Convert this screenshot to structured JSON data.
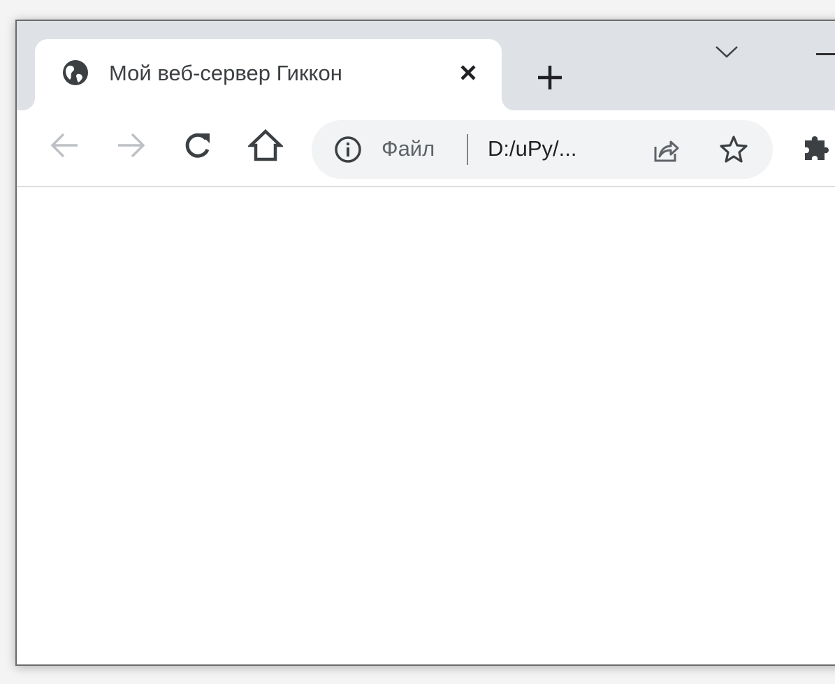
{
  "tab": {
    "title": "Мой веб-сервер Гиккон",
    "favicon": "globe-icon",
    "close_icon": "close-icon"
  },
  "tabstrip": {
    "new_tab_icon": "plus-icon",
    "tab_search_icon": "chevron-down-icon"
  },
  "window_controls": {
    "minimize_icon": "minimize-icon"
  },
  "toolbar": {
    "back_icon": "arrow-left-icon",
    "forward_icon": "arrow-right-icon",
    "reload_icon": "reload-icon",
    "home_icon": "home-icon",
    "extensions_icon": "puzzle-icon"
  },
  "omnibox": {
    "info_icon": "info-icon",
    "scheme_label": "Файл",
    "url": "D:/uPy/...",
    "share_icon": "share-icon",
    "bookmark_icon": "star-icon"
  },
  "colors": {
    "tabstrip_bg": "#dee1e6",
    "tab_bg": "#ffffff",
    "omnibox_bg": "#f1f3f4",
    "icon_dark": "#3c4043",
    "icon_disabled": "#bdc1c6"
  }
}
